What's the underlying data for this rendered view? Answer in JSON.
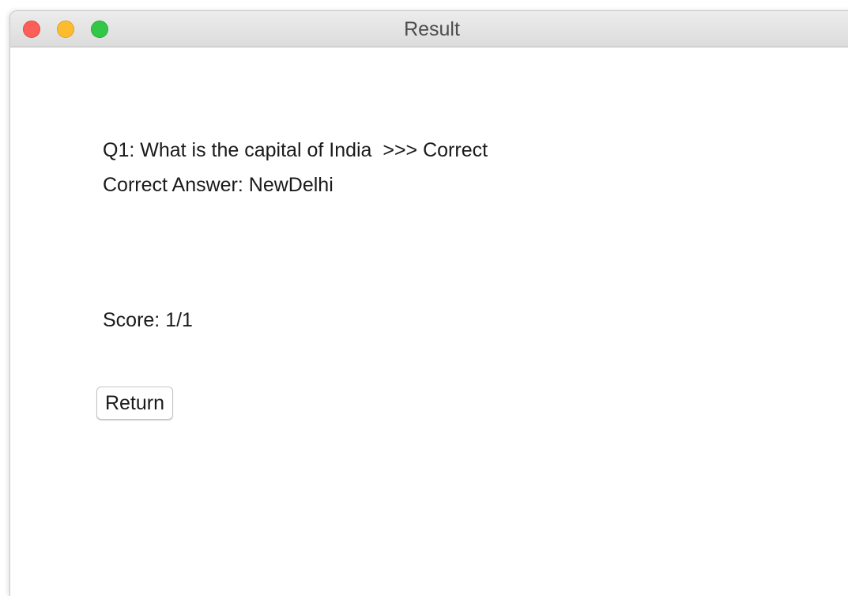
{
  "window": {
    "title": "Result",
    "controls": {
      "close_color": "#fc5f57",
      "minimize_color": "#fdbc2e",
      "zoom_color": "#33c748"
    }
  },
  "result": {
    "question_line": "Q1: What is the capital of India  >>> Correct",
    "answer_line": "Correct Answer: NewDelhi",
    "score_line": "Score: 1/1"
  },
  "actions": {
    "return_label": "Return"
  }
}
